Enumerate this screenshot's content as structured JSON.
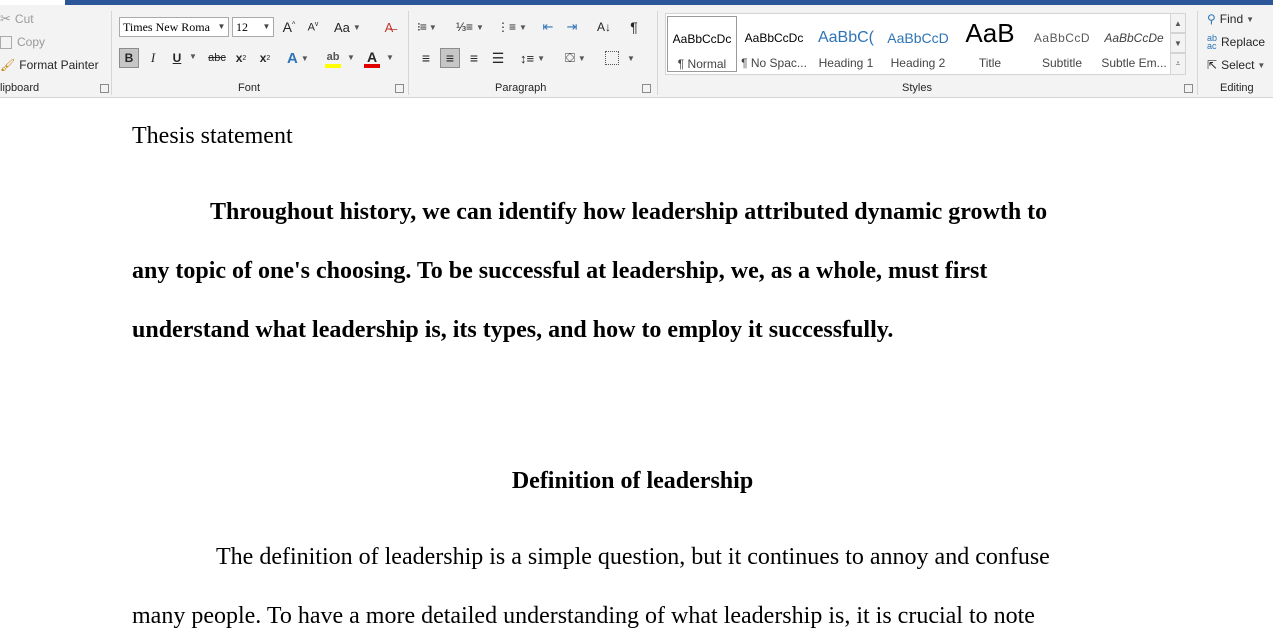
{
  "ribbon": {
    "clipboard": {
      "label": "lipboard",
      "cut": "Cut",
      "copy": "Copy",
      "format_painter": "Format Painter"
    },
    "font": {
      "label": "Font",
      "font_name": "Times New Roma",
      "font_size": "12",
      "change_case": "Aa",
      "bold": "B",
      "italic": "I",
      "underline": "U",
      "strikethrough": "abc",
      "subscript": "x",
      "superscript": "x",
      "highlight_color": "#ffff00",
      "font_color": "#e00000"
    },
    "paragraph": {
      "label": "Paragraph"
    },
    "styles": {
      "label": "Styles",
      "items": [
        {
          "preview": "AaBbCcDc",
          "name": "¶ Normal"
        },
        {
          "preview": "AaBbCcDc",
          "name": "¶ No Spac..."
        },
        {
          "preview": "AaBbC(",
          "name": "Heading 1"
        },
        {
          "preview": "AaBbCcD",
          "name": "Heading 2"
        },
        {
          "preview": "AaB",
          "name": "Title"
        },
        {
          "preview": "AaBbCcD",
          "name": "Subtitle"
        },
        {
          "preview": "AaBbCcDe",
          "name": "Subtle Em..."
        }
      ]
    },
    "editing": {
      "label": "Editing",
      "find": "Find",
      "replace": "Replace",
      "select": "Select"
    }
  },
  "document": {
    "heading_thesis": "Thesis statement",
    "thesis_lines": [
      "Throughout history, we can identify how leadership attributed dynamic growth to",
      "any topic of one's choosing. To be successful at leadership, we, as a whole, must first",
      "understand what leadership is, its types, and how to employ it successfully."
    ],
    "heading_definition": "Definition of leadership",
    "body_lines": [
      "The definition of leadership is a simple question, but it continues to annoy and confuse",
      "many people. To have a more detailed understanding of what leadership is, it is crucial to note"
    ]
  },
  "colors": {
    "title_bar_blue": "#2b579a",
    "ribbon_bg": "#f3f3f3",
    "heading_style_blue": "#2e74b5"
  }
}
